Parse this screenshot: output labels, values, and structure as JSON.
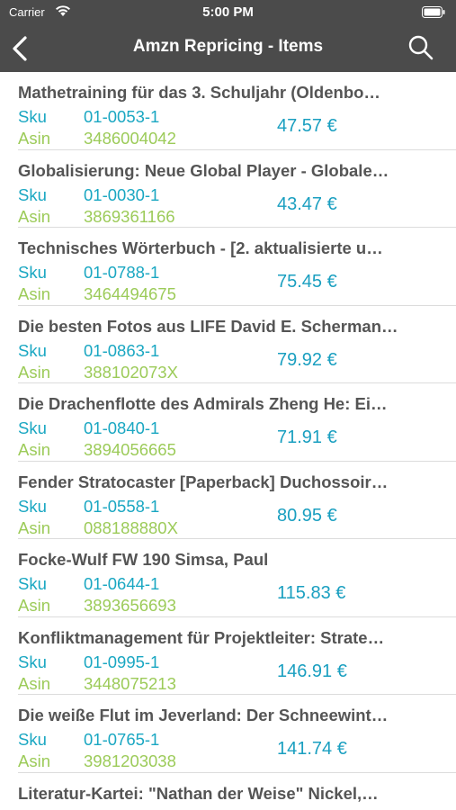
{
  "status_bar": {
    "carrier": "Carrier",
    "time": "5:00 PM"
  },
  "nav": {
    "title": "Amzn Repricing - Items"
  },
  "labels": {
    "sku": "Sku",
    "asin": "Asin"
  },
  "items": [
    {
      "title": "Mathetraining für das 3. Schuljahr (Oldenbo…",
      "sku": "01-0053-1",
      "asin": "3486004042",
      "price": "47.57 €"
    },
    {
      "title": "Globalisierung: Neue Global Player - Globale…",
      "sku": "01-0030-1",
      "asin": "3869361166",
      "price": "43.47 €"
    },
    {
      "title": "Technisches Wörterbuch - [2. aktualisierte u…",
      "sku": "01-0788-1",
      "asin": "3464494675",
      "price": "75.45 €"
    },
    {
      "title": "Die besten Fotos aus LIFE David E. Scherman…",
      "sku": "01-0863-1",
      "asin": "388102073X",
      "price": "79.92 €"
    },
    {
      "title": "Die Drachenflotte des Admirals Zheng He: Ei…",
      "sku": "01-0840-1",
      "asin": "3894056665",
      "price": "71.91 €"
    },
    {
      "title": "Fender Stratocaster [Paperback] Duchossoir…",
      "sku": "01-0558-1",
      "asin": "088188880X",
      "price": "80.95 €"
    },
    {
      "title": "Focke-Wulf FW 190 Simsa, Paul",
      "sku": "01-0644-1",
      "asin": "3893656693",
      "price": "115.83 €"
    },
    {
      "title": "Konfliktmanagement für Projektleiter: Strate…",
      "sku": "01-0995-1",
      "asin": "3448075213",
      "price": "146.91 €"
    },
    {
      "title": "Die weiße Flut im Jeverland: Der Schneewint…",
      "sku": "01-0765-1",
      "asin": "3981203038",
      "price": "141.74 €"
    },
    {
      "title": "Literatur-Kartei: \"Nathan der Weise\" Nickel,…",
      "sku": "",
      "asin": "",
      "price": ""
    }
  ],
  "colors": {
    "header_bg": "#4b4b4b",
    "title": "#555555",
    "sku": "#1aa7c2",
    "asin": "#9ccb59",
    "price": "#1a9fc0",
    "separator": "#dcdcdc"
  },
  "icons": {
    "back": "chevron-left-icon",
    "search": "search-icon",
    "wifi": "wifi-icon",
    "battery": "battery-icon"
  }
}
